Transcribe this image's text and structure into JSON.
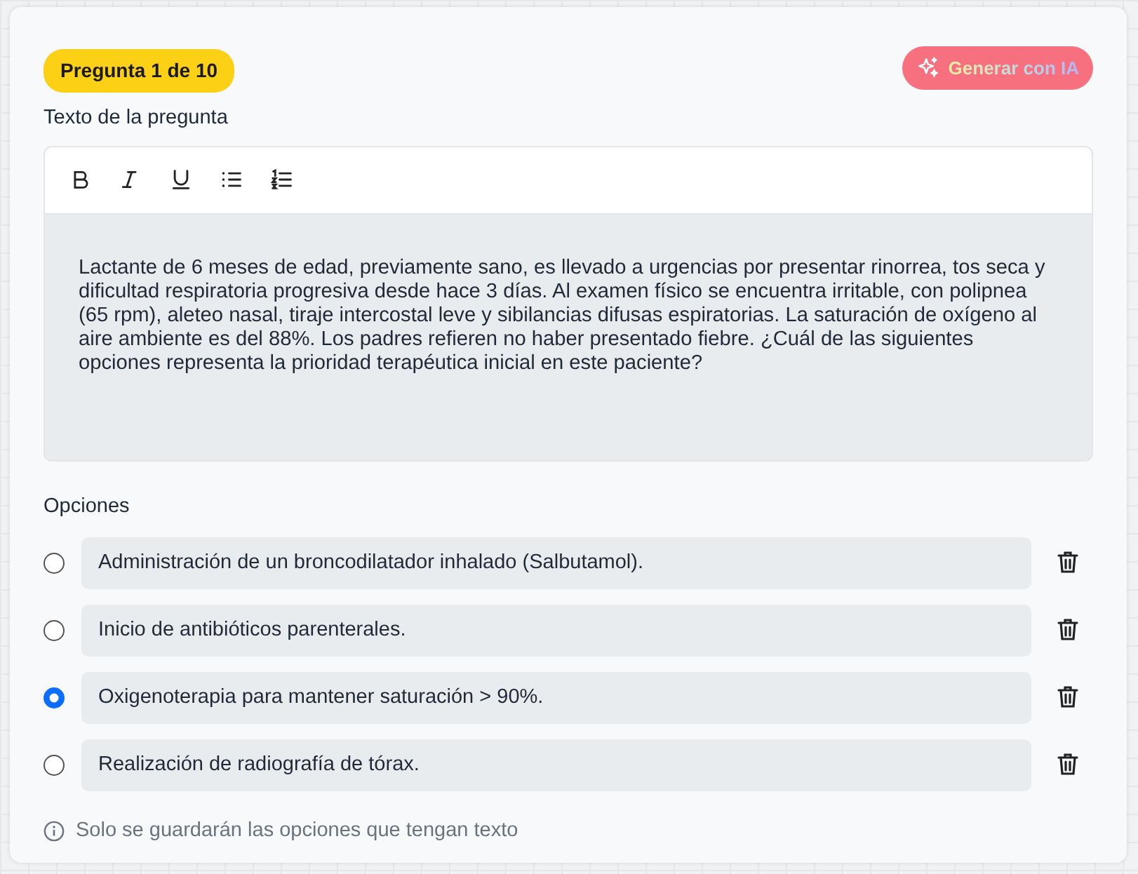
{
  "badge": "Pregunta 1 de 10",
  "generate_button": "Generar con IA",
  "question_label": "Texto de la pregunta",
  "toolbar": [
    {
      "kind": "bold"
    },
    {
      "kind": "italic"
    },
    {
      "kind": "underline"
    },
    {
      "kind": "bullet-list"
    },
    {
      "kind": "numbered-list"
    }
  ],
  "question_text": "Lactante de 6 meses de edad, previamente sano, es llevado a urgencias por presentar rinorrea, tos seca y dificultad respiratoria progresiva desde hace 3 días. Al examen físico se encuentra irritable, con polipnea (65 rpm), aleteo nasal, tiraje intercostal leve y sibilancias difusas espiratorias. La saturación de oxígeno al aire ambiente es del 88%. Los padres refieren no haber presentado fiebre. ¿Cuál de las siguientes opciones representa la prioridad terapéutica inicial en este paciente?",
  "options_label": "Opciones",
  "options": [
    {
      "text": "Administración de un broncodilatador inhalado (Salbutamol).",
      "selected": false
    },
    {
      "text": "Inicio de antibióticos parenterales.",
      "selected": false
    },
    {
      "text": "Oxigenoterapia para mantener saturación > 90%.",
      "selected": true
    },
    {
      "text": "Realización de radiografía de tórax.",
      "selected": false
    }
  ],
  "hint": "Solo se guardarán las opciones que tengan texto"
}
